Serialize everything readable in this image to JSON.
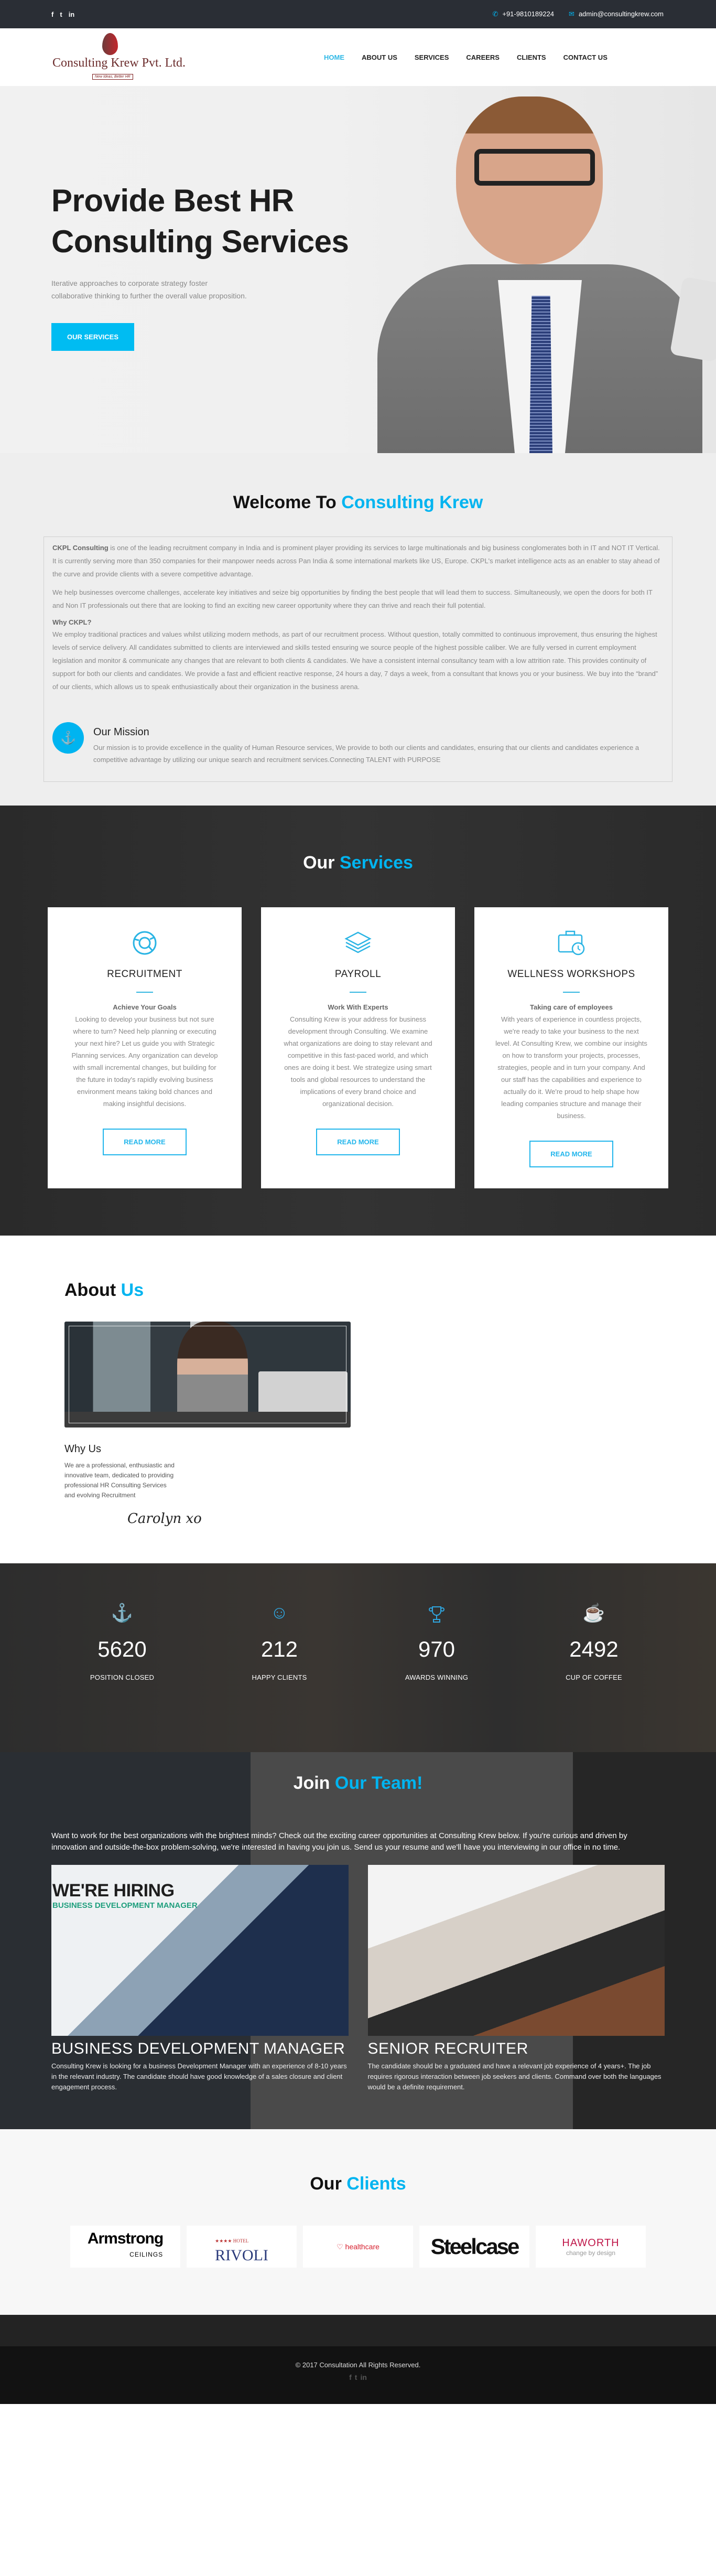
{
  "topbar": {
    "social": [
      "f",
      "t",
      "in"
    ],
    "phone": "+91-9810189224",
    "email": "admin@consultingkrew.com"
  },
  "header": {
    "logo_name": "Consulting Krew Pvt. Ltd.",
    "logo_tagline": "New Ideas, Better HR",
    "nav": [
      "HOME",
      "ABOUT US",
      "SERVICES",
      "CAREERS",
      "CLIENTS",
      "CONTACT US"
    ],
    "active_nav": "HOME"
  },
  "hero": {
    "title_line1": "Provide Best HR",
    "title_line2": "Consulting Services",
    "subtitle": "Iterative approaches to corporate strategy foster collaborative thinking to further the overall value proposition.",
    "cta": "OUR SERVICES"
  },
  "welcome": {
    "title_plain": "Welcome To",
    "title_accent": "Consulting Krew",
    "intro_bold": "CKPL Consulting",
    "intro_rest": " is one of the leading recruitment company in India and is prominent player providing its services to large multinationals and big business conglomerates both in IT and NOT IT Vertical. It is currently serving more than 350 companies for their manpower needs across Pan India & some international markets like US, Europe. CKPL's market intelligence acts as an enabler to stay ahead of the curve and provide clients with a severe competitive advantage.",
    "para2": "We help businesses overcome challenges, accelerate key initiatives and seize big opportunities by finding the best people that will lead them to success. Simultaneously, we open the doors for both IT and Non IT professionals out there that are looking to find an exciting new career opportunity where they can thrive and reach their full potential.",
    "why_title": "Why CKPL?",
    "why_text": "We employ traditional practices and values whilst utilizing modern methods, as part of our recruitment process. Without question, totally committed to continuous improvement, thus ensuring the highest levels of service delivery. All candidates submitted to clients are interviewed and skills tested ensuring we source people of the highest possible caliber. We are fully versed in current employment legislation and monitor & communicate any changes that are relevant to both clients & candidates. We have a consistent internal consultancy team with a low attrition rate. This provides continuity of support for both our clients and candidates. We provide a fast and efficient reactive response, 24 hours a day, 7 days a week, from a consultant that knows you or your business. We buy into the “brand” of our clients, which allows us to speak enthusiastically about their organization in the business arena.",
    "mission_title": "Our Mission",
    "mission_text": "Our mission is to provide excellence in the quality of Human Resource services, We provide to both our clients and candidates, ensuring that our clients and candidates experience a competitive advantage by utilizing our unique search and recruitment services.Connecting TALENT with PURPOSE"
  },
  "services": {
    "title_plain": "Our",
    "title_accent": "Services",
    "cards": [
      {
        "icon": "lifebuoy-icon",
        "title": "RECRUITMENT",
        "subtitle": "Achieve Your Goals",
        "text": "Looking to develop your business but not sure where to turn? Need help planning or executing your next hire? Let us guide you with Strategic Planning services. Any organization can develop with small incremental changes, but building for the future in today's rapidly evolving business environment means taking bold chances and making insightful decisions.",
        "button": "READ MORE"
      },
      {
        "icon": "layers-icon",
        "title": "PAYROLL",
        "subtitle": "Work With Experts",
        "text": "Consulting Krew is your address for business development through Consulting. We examine what organizations are doing to stay relevant and competitive in this fast-paced world, and which ones are doing it best. We strategize using smart tools and global resources to understand the implications of every brand choice and organizational decision.",
        "button": "READ MORE"
      },
      {
        "icon": "briefcase-clock-icon",
        "title": "WELLNESS WORKSHOPS",
        "subtitle": "Taking care of employees",
        "text": "With years of experience in countless projects, we're ready to take your business to the next level. At Consulting Krew, we combine our insights on how to transform your projects, processes, strategies, people and in turn your company. And our staff has the capabilities and experience to actually do it. We're proud to help shape how leading companies structure and manage their business.",
        "button": "READ MORE"
      }
    ]
  },
  "about": {
    "title_plain": "About",
    "title_accent": "Us",
    "why_title": "Why Us",
    "why_text": "We are a professional, enthusiastic and innovative team, dedicated to providing professional HR Consulting Services and evolving Recruitment",
    "signature": "Carolyn xo"
  },
  "stats": [
    {
      "icon": "anchor-icon",
      "glyph": "⚓",
      "value": "5620",
      "label": "POSITION CLOSED"
    },
    {
      "icon": "smiley-icon",
      "glyph": "☺",
      "value": "212",
      "label": "HAPPY CLIENTS"
    },
    {
      "icon": "trophy-icon",
      "glyph": "🏆",
      "value": "970",
      "label": "AWARDS WINNING"
    },
    {
      "icon": "coffee-cup-icon",
      "glyph": "☕",
      "value": "2492",
      "label": "CUP OF COFFEE"
    }
  ],
  "careers": {
    "title_plain": "Join",
    "title_accent": "Our Team!",
    "intro": "Want to work for the best organizations with the brightest minds? Check out the exciting career opportunities at Consulting Krew below. If you're curious and driven by innovation and outside-the-box problem-solving, we're interested in having you join us. Send us your resume and we'll have you interviewing in our office in no time.",
    "jobs": [
      {
        "image_heading": "WE'RE HIRING",
        "image_sub": "BUSINESS DEVELOPMENT MANAGER",
        "title": "BUSINESS DEVELOPMENT MANAGER",
        "text": "Consulting Krew is looking for a business Development Manager with an experience of 8-10 years in the relevant industry. The candidate should have good knowledge of a sales closure and client engagement process."
      },
      {
        "title": "SENIOR RECRUITER",
        "text": "The candidate should be a graduated and have a relevant job experience of 4 years+. The job requires rigorous interaction between job seekers and clients. Command over both the languages would be a definite requirement."
      }
    ]
  },
  "clients": {
    "title_plain": "Our",
    "title_accent": "Clients",
    "logos": [
      {
        "name": "Armstrong",
        "sub": "CEILINGS"
      },
      {
        "name": "RIVOLI",
        "sub": "★★★★ HOTEL"
      },
      {
        "name": "healthcare",
        "sub": ""
      },
      {
        "name": "Steelcase",
        "sub": ""
      },
      {
        "name": "HAWORTH",
        "sub": "change by design"
      }
    ]
  },
  "footer": {
    "copyright": "© 2017 Consultation All Rights Reserved.",
    "social": [
      "f",
      "t",
      "in"
    ]
  }
}
